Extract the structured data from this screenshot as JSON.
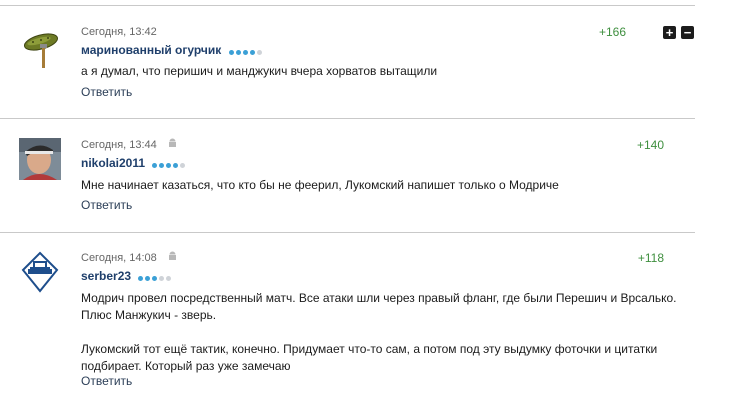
{
  "comments": [
    {
      "time": "Сегодня, 13:42",
      "author": "маринованный огурчик",
      "rating_dots": 4,
      "text": [
        "а я думал, что перишич и манджукич вчера хорватов вытащили"
      ],
      "reply": "Ответить",
      "score": "+166",
      "device_icon": null,
      "avatar_icon": "pickle-on-fork-icon",
      "vote_plus": "+",
      "vote_minus": "−"
    },
    {
      "time": "Сегодня, 13:44",
      "author": "nikolai2011",
      "rating_dots": 4,
      "text": [
        "Мне начинает казаться, что кто бы не фeeрил, Лукомский напишет только о Модриче"
      ],
      "reply": "Ответить",
      "score": "+140",
      "device_icon": "android-icon",
      "avatar_icon": "person-photo-icon"
    },
    {
      "time": "Сегодня, 14:08",
      "author": "serber23",
      "rating_dots": 3,
      "text": [
        "Модрич провел посредственный матч. Все атаки шли через правый фланг, где были Перешич и Врсалько.",
        "Плюс Манжукич - зверь.",
        "",
        "Лукомский тот ещё тактик, конечно. Придумает что-то сам, а потом под эту выдумку фоточки и цитатки",
        "подбирает. Который раз уже замечаю"
      ],
      "reply": "Ответить",
      "score": "+118",
      "device_icon": "android-icon",
      "avatar_icon": "dynamo-logo-icon"
    }
  ],
  "colors": {
    "author": "#1f3f6b",
    "score": "#3f8f3f",
    "dot_on": "#3ba0d6",
    "dot_off": "#cfd3d8"
  }
}
